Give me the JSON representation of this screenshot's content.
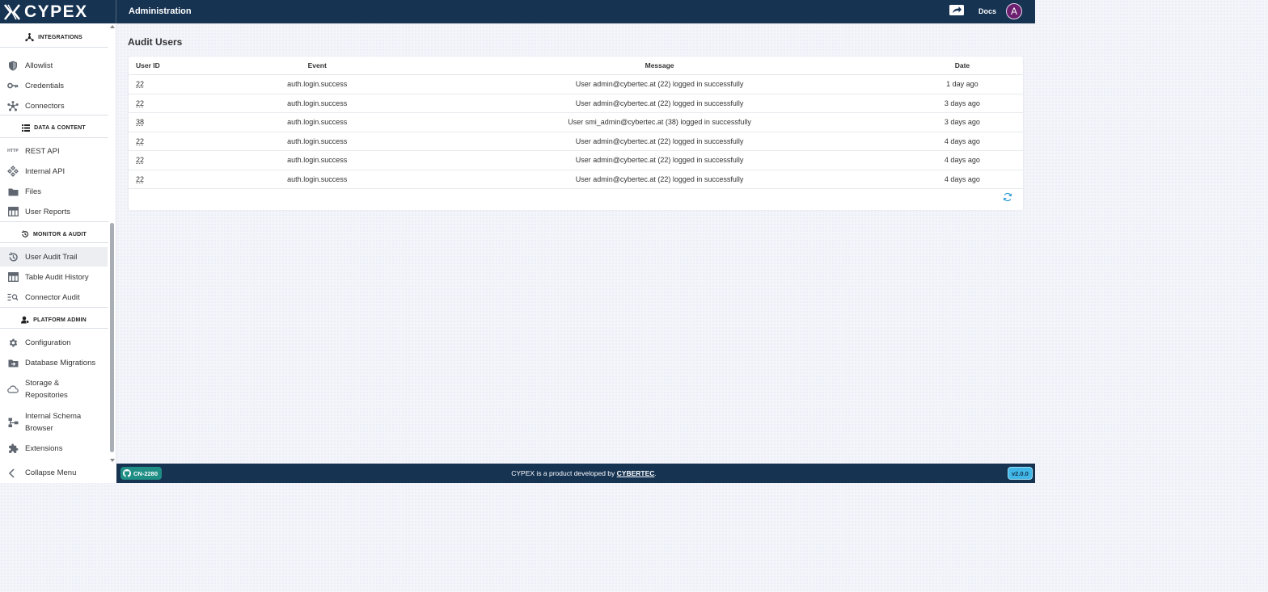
{
  "header": {
    "logo_text": "CYPEX",
    "title": "Administration",
    "docs_label": "Docs",
    "avatar_initial": "A"
  },
  "sidebar": {
    "sections": {
      "integrations": "INTEGRATIONS",
      "data_content": "DATA & CONTENT",
      "monitor_audit": "MONITOR & AUDIT",
      "platform_admin": "PLATFORM ADMIN"
    },
    "items": {
      "allowlist": "Allowlist",
      "credentials": "Credentials",
      "connectors": "Connectors",
      "rest_api": "REST API",
      "internal_api": "Internal API",
      "files": "Files",
      "user_reports": "User Reports",
      "user_audit_trail": "User Audit Trail",
      "table_audit_history": "Table Audit History",
      "connector_audit": "Connector Audit",
      "configuration": "Configuration",
      "database_migrations": "Database Migrations",
      "storage_repositories_1": "Storage &",
      "storage_repositories_2": "Repositories",
      "internal_schema_browser_1": "Internal Schema",
      "internal_schema_browser_2": "Browser",
      "extensions": "Extensions"
    },
    "rest_api_icon_text": "HTTP",
    "collapse_label": "Collapse Menu"
  },
  "main": {
    "title": "Audit Users",
    "table": {
      "columns": [
        "User ID",
        "Event",
        "Message",
        "Date"
      ],
      "rows": [
        [
          "22",
          "auth.login.success",
          "User admin@cybertec.at (22) logged in successfully",
          "1 day ago"
        ],
        [
          "22",
          "auth.login.success",
          "User admin@cybertec.at (22) logged in successfully",
          "3 days ago"
        ],
        [
          "38",
          "auth.login.success",
          "User smi_admin@cybertec.at (38) logged in successfully",
          "3 days ago"
        ],
        [
          "22",
          "auth.login.success",
          "User admin@cybertec.at (22) logged in successfully",
          "4 days ago"
        ],
        [
          "22",
          "auth.login.success",
          "User admin@cybertec.at (22) logged in successfully",
          "4 days ago"
        ],
        [
          "22",
          "auth.login.success",
          "User admin@cybertec.at (22) logged in successfully",
          "4 days ago"
        ]
      ]
    }
  },
  "footer": {
    "branch": "CN-2280",
    "text_prefix": "CYPEX is a product developed by ",
    "company": "CYBERTEC",
    "text_suffix": ".",
    "version": "v2.0.0"
  },
  "colors": {
    "header_bg": "#163352",
    "branch_chip": "#1f8f86",
    "version_chip": "#40b7e6",
    "avatar": "#6b1f6e",
    "refresh_icon": "#2f9bd6"
  }
}
